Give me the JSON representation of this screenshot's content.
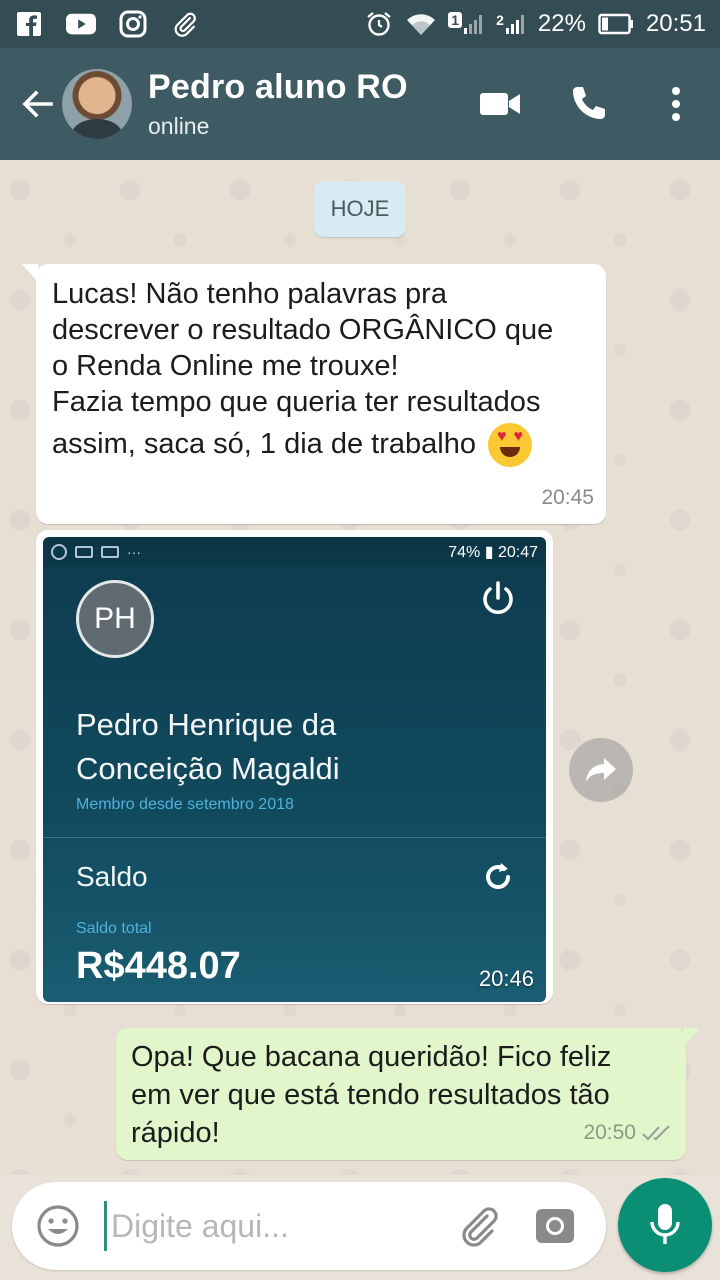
{
  "status_bar": {
    "sim1": "1",
    "sim2": "2",
    "battery": "22%",
    "time": "20:51",
    "icons": [
      "facebook-icon",
      "youtube-icon",
      "instagram-icon",
      "paperclip-icon",
      "alarm-icon",
      "wifi-icon",
      "signal-icon",
      "battery-icon"
    ]
  },
  "header": {
    "contact_name": "Pedro aluno RO",
    "status": "online",
    "icons": [
      "back-arrow-icon",
      "video-call-icon",
      "phone-call-icon",
      "more-options-icon"
    ],
    "background": "#3e5b63"
  },
  "chat": {
    "date_chip": "HOJE",
    "incoming_text": {
      "lines": [
        "Lucas! Não tenho palavras pra",
        "descrever o resultado ORGÂNICO que",
        "o Renda Online me trouxe!",
        "Fazia tempo que queria ter resultados",
        "assim, saca só, 1 dia de trabalho"
      ],
      "emoji": "heart-eyes-emoji",
      "time": "20:45"
    },
    "image_message": {
      "screenshot": {
        "status_right": "74% ▮ 20:47",
        "avatar_initials": "PH",
        "name_line1": "Pedro Henrique da",
        "name_line2": "Conceição Magaldi",
        "member_since": "Membro desde setembro 2018",
        "balance_label": "Saldo",
        "total_label": "Saldo total",
        "amount": "R$448.07"
      },
      "time": "20:46"
    },
    "outgoing_text": {
      "lines": [
        "Opa! Que bacana queridão! Fico feliz",
        "em ver que está tendo resultados tão",
        "rápido!"
      ],
      "time": "20:50",
      "read_ticks": "double-check-icon"
    }
  },
  "composer": {
    "placeholder": "Digite aqui...",
    "icons": [
      "emoji-icon",
      "attach-icon",
      "camera-icon",
      "mic-icon"
    ],
    "mic_color": "#0b8f74"
  }
}
